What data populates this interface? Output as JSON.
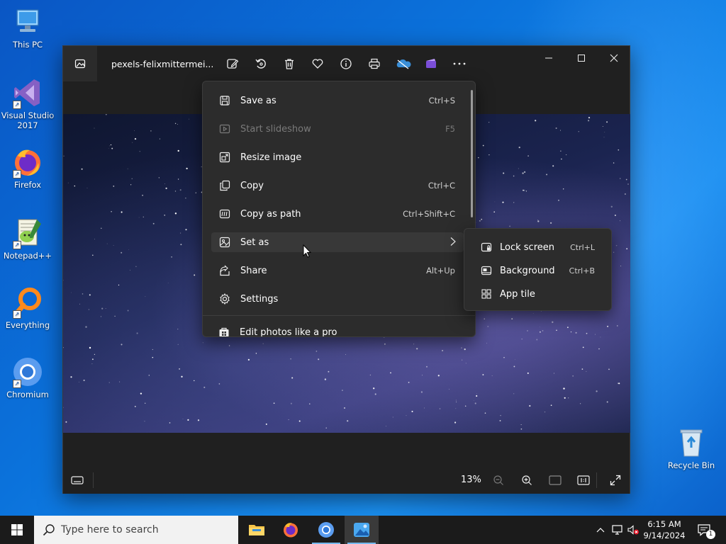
{
  "desktop": {
    "icons": [
      {
        "label": "This PC"
      },
      {
        "label": "Visual Studio 2017"
      },
      {
        "label": "Firefox"
      },
      {
        "label": "Notepad++"
      },
      {
        "label": "Everything"
      },
      {
        "label": "Chromium"
      },
      {
        "label": "Recycle Bin"
      }
    ]
  },
  "window": {
    "file_title": "pexels-felixmittermei...",
    "toolbar_icons": [
      "edit-image-icon",
      "rotate-icon",
      "delete-icon",
      "favorite-icon",
      "info-icon",
      "print-icon",
      "onedrive-icon",
      "clipchamp-icon",
      "more-icon"
    ],
    "zoom": "13%"
  },
  "menu": {
    "items": [
      {
        "label": "Save as",
        "shortcut": "Ctrl+S",
        "icon": "save-icon"
      },
      {
        "label": "Start slideshow",
        "shortcut": "F5",
        "icon": "slideshow-icon"
      },
      {
        "label": "Resize image",
        "shortcut": "",
        "icon": "resize-icon"
      },
      {
        "label": "Copy",
        "shortcut": "Ctrl+C",
        "icon": "copy-icon"
      },
      {
        "label": "Copy as path",
        "shortcut": "Ctrl+Shift+C",
        "icon": "copy-path-icon"
      },
      {
        "label": "Set as",
        "shortcut": "",
        "icon": "set-as-icon"
      },
      {
        "label": "Share",
        "shortcut": "Alt+Up",
        "icon": "share-icon"
      },
      {
        "label": "Settings",
        "shortcut": "",
        "icon": "settings-icon"
      },
      {
        "label": "Edit photos like a pro",
        "shortcut": "",
        "icon": "store-icon"
      }
    ]
  },
  "submenu": {
    "items": [
      {
        "label": "Lock screen",
        "shortcut": "Ctrl+L",
        "icon": "lock-screen-icon"
      },
      {
        "label": "Background",
        "shortcut": "Ctrl+B",
        "icon": "background-icon"
      },
      {
        "label": "App tile",
        "shortcut": "",
        "icon": "app-tile-icon"
      }
    ]
  },
  "taskbar": {
    "search_placeholder": "Type here to search",
    "time": "6:15 AM",
    "date": "9/14/2024",
    "notification_count": "1"
  }
}
